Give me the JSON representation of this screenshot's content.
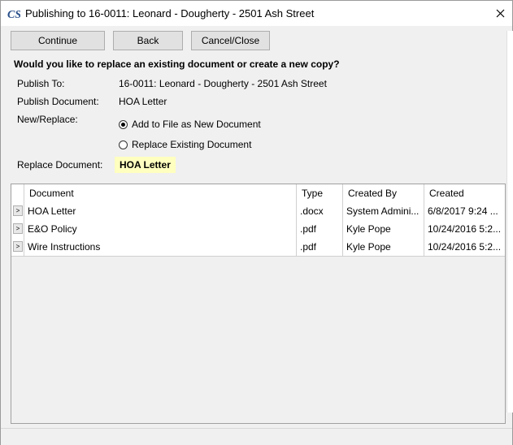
{
  "window": {
    "title": "Publishing to 16-0011: Leonard - Dougherty - 2501 Ash Street",
    "logo_icon": "cs-logo-icon",
    "close_icon": "close-icon"
  },
  "toolbar": {
    "continue_label": "Continue",
    "back_label": "Back",
    "cancel_label": "Cancel/Close"
  },
  "question": "Would you like to replace an existing document or create a new copy?",
  "form": {
    "publish_to_label": "Publish To:",
    "publish_to_value": "16-0011: Leonard - Dougherty - 2501 Ash Street",
    "publish_document_label": "Publish Document:",
    "publish_document_value": "HOA Letter",
    "new_replace_label": "New/Replace:",
    "option_new": "Add to File as New Document",
    "option_replace": "Replace Existing Document",
    "selected_option": "new",
    "replace_document_label": "Replace Document:",
    "replace_document_value": "HOA Letter",
    "highlight_color": "#ffffc0"
  },
  "grid": {
    "columns": [
      "Document",
      "Type",
      "Created By",
      "Created"
    ],
    "expander_glyph": ">",
    "rows": [
      {
        "document": "HOA Letter",
        "type": ".docx",
        "created_by": "System Admini...",
        "created": "6/8/2017 9:24 ..."
      },
      {
        "document": "E&O Policy",
        "type": ".pdf",
        "created_by": "Kyle Pope",
        "created": "10/24/2016 5:2..."
      },
      {
        "document": "Wire Instructions",
        "type": ".pdf",
        "created_by": "Kyle Pope",
        "created": "10/24/2016 5:2..."
      }
    ]
  }
}
